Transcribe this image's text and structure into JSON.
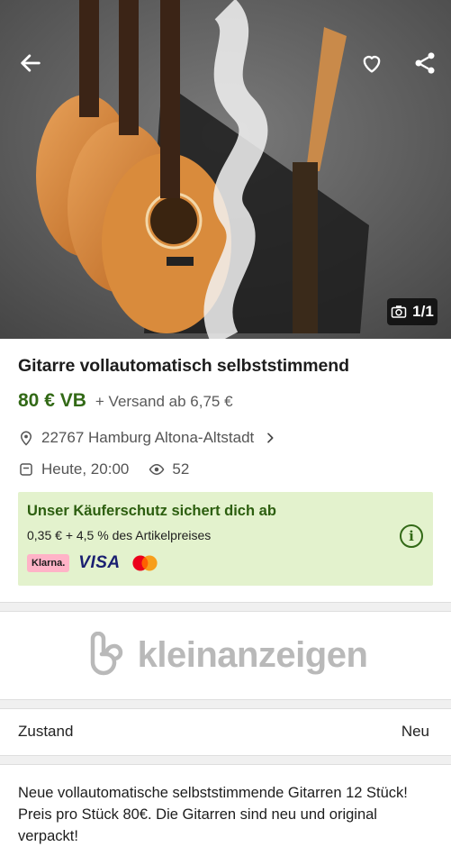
{
  "photo": {
    "counter": "1/1",
    "icons": {
      "back": "arrow-left-icon",
      "favorite": "heart-icon",
      "share": "share-icon",
      "camera": "camera-icon"
    }
  },
  "listing": {
    "title": "Gitarre vollautomatisch selbststimmend",
    "price": "80 € VB",
    "shipping": "+ Versand ab 6,75 €",
    "location": "22767 Hamburg Altona-Altstadt",
    "date": "Heute, 20:00",
    "views": "52"
  },
  "buyer_protection": {
    "title": "Unser Käuferschutz sichert dich ab",
    "fee": "0,35 € + 4,5 % des Artikelpreises",
    "info_symbol": "i",
    "payments": {
      "klarna": "Klarna.",
      "visa": "VISA",
      "mastercard": "mastercard-icon"
    }
  },
  "brand": {
    "name": "kleinanzeigen"
  },
  "details": {
    "condition_label": "Zustand",
    "condition_value": "Neu"
  },
  "description": "Neue vollautomatische selbststimmende Gitarren 12 Stück! Preis pro Stück 80€. Die Gitarren sind neu und original verpackt!",
  "colors": {
    "price_green": "#326916",
    "protect_bg": "#e3f2cd",
    "brand_gray": "#b9b9b9"
  }
}
